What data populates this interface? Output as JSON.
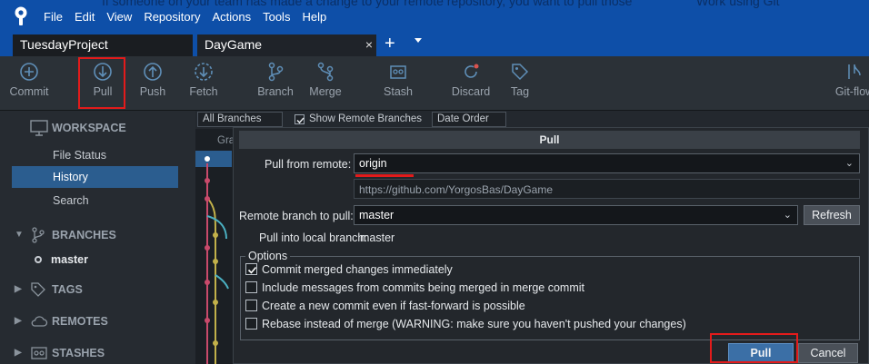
{
  "menubar": {
    "items": [
      "File",
      "Edit",
      "View",
      "Repository",
      "Actions",
      "Tools",
      "Help"
    ],
    "background_text": "If someone on your team has made a change to your remote repository, you want to pull those",
    "background_text_right": "Work using Git"
  },
  "tabs": {
    "items": [
      {
        "label": "TuesdayProject"
      },
      {
        "label": "DayGame",
        "active": true
      }
    ],
    "close_glyph": "×",
    "add_glyph": "+"
  },
  "toolbar": {
    "items": [
      {
        "label": "Commit",
        "icon": "commit-icon"
      },
      {
        "label": "Pull",
        "icon": "pull-icon"
      },
      {
        "label": "Push",
        "icon": "push-icon"
      },
      {
        "label": "Fetch",
        "icon": "fetch-icon"
      },
      {
        "label": "Branch",
        "icon": "branch-icon"
      },
      {
        "label": "Merge",
        "icon": "merge-icon"
      },
      {
        "label": "Stash",
        "icon": "stash-icon"
      },
      {
        "label": "Discard",
        "icon": "discard-icon"
      },
      {
        "label": "Tag",
        "icon": "tag-icon"
      },
      {
        "label": "Git-flow",
        "icon": "git-flow-icon"
      }
    ]
  },
  "sidebar": {
    "workspace": "WORKSPACE",
    "workspace_items": [
      "File Status",
      "History",
      "Search"
    ],
    "selected": "History",
    "branches": "BRANCHES",
    "branch_items": [
      "master"
    ],
    "tags": "TAGS",
    "remotes": "REMOTES",
    "stashes": "STASHES"
  },
  "filterbar": {
    "branches_value": "All Branches",
    "show_remote": "Show Remote Branches",
    "order_value": "Date Order",
    "graph_header": "Gra"
  },
  "dialog": {
    "title": "Pull",
    "pull_from_remote_label": "Pull from remote:",
    "remote_value": "origin",
    "remote_url": "https://github.com/YorgosBas/DayGame",
    "remote_branch_label": "Remote branch to pull:",
    "remote_branch_value": "master",
    "refresh_label": "Refresh",
    "local_branch_label": "Pull into local branch:",
    "local_branch_value": "master",
    "options_legend": "Options",
    "options": [
      {
        "label": "Commit merged changes immediately",
        "checked": true
      },
      {
        "label": "Include messages from commits being merged in merge commit",
        "checked": false
      },
      {
        "label": "Create a new commit even if fast-forward is possible",
        "checked": false
      },
      {
        "label": "Rebase instead of merge (WARNING: make sure you haven't pushed your changes)",
        "checked": false
      }
    ],
    "pull_button": "Pull",
    "cancel_button": "Cancel"
  },
  "colors": {
    "menubar": "#0e4fa8",
    "toolbar": "#2b3137",
    "highlight": "#e21b1b",
    "selection": "#2b5d8f",
    "primary_button": "#3b6fa6"
  }
}
